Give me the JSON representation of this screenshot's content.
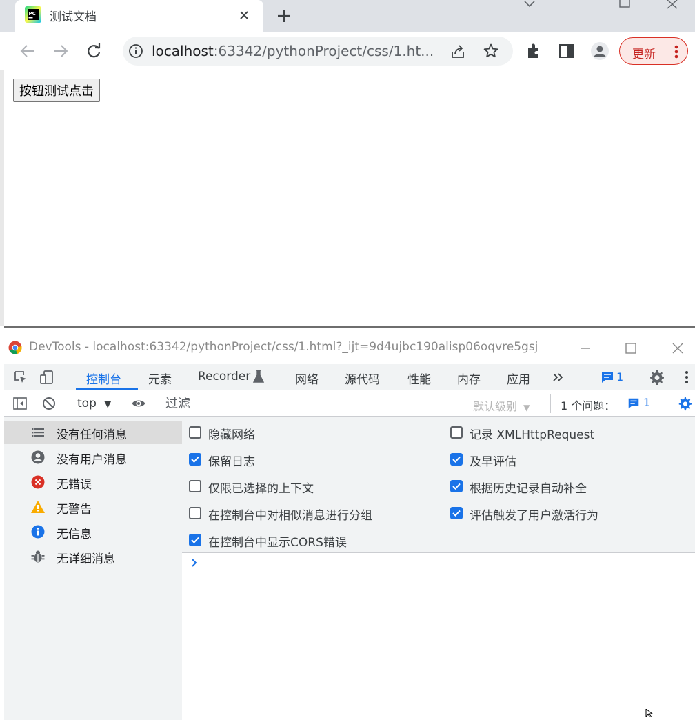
{
  "browser": {
    "tab_title": "测试文档",
    "url_host": "localhost",
    "url_path": ":63342/pythonProject/css/1.ht...",
    "update_label": "更新",
    "accent": "#1a73e8",
    "update_color": "#d93025"
  },
  "page": {
    "button_label": "按钮测试点击"
  },
  "devtools": {
    "window_title": "DevTools - localhost:63342/pythonProject/css/1.html?_ijt=9d4ujbc190alisp06oqvre5gsj",
    "tabs": [
      {
        "label": "控制台",
        "active": true
      },
      {
        "label": "元素"
      },
      {
        "label": "Recorder"
      },
      {
        "label": "网络"
      },
      {
        "label": "源代码"
      },
      {
        "label": "性能"
      },
      {
        "label": "内存"
      },
      {
        "label": "应用"
      }
    ],
    "more_tabs_icon": "chevron-double-right-icon",
    "issues_badge_count": "1",
    "filter_bar": {
      "context": "top",
      "filter_placeholder": "过滤",
      "level": "默认级别",
      "issues_label": "1 个问题：",
      "issues_count": "1"
    },
    "sidebar": [
      {
        "label": "没有任何消息",
        "icon": "list-icon",
        "selected": true
      },
      {
        "label": "没有用户消息",
        "icon": "user-icon"
      },
      {
        "label": "无错误",
        "icon": "error-icon"
      },
      {
        "label": "无警告",
        "icon": "warning-icon"
      },
      {
        "label": "无信息",
        "icon": "info-icon"
      },
      {
        "label": "无详细消息",
        "icon": "bug-icon"
      }
    ],
    "settings": {
      "left": [
        {
          "label": "隐藏网络",
          "checked": false
        },
        {
          "label": "保留日志",
          "checked": true
        },
        {
          "label": "仅限已选择的上下文",
          "checked": false
        },
        {
          "label": "在控制台中对相似消息进行分组",
          "checked": false
        },
        {
          "label": "在控制台中显示CORS错误",
          "checked": true
        }
      ],
      "right": [
        {
          "label": "记录 XMLHttpRequest",
          "checked": false
        },
        {
          "label": "及早评估",
          "checked": true
        },
        {
          "label": "根据历史记录自动补全",
          "checked": true
        },
        {
          "label": "评估触发了用户激活行为",
          "checked": true
        }
      ]
    }
  }
}
